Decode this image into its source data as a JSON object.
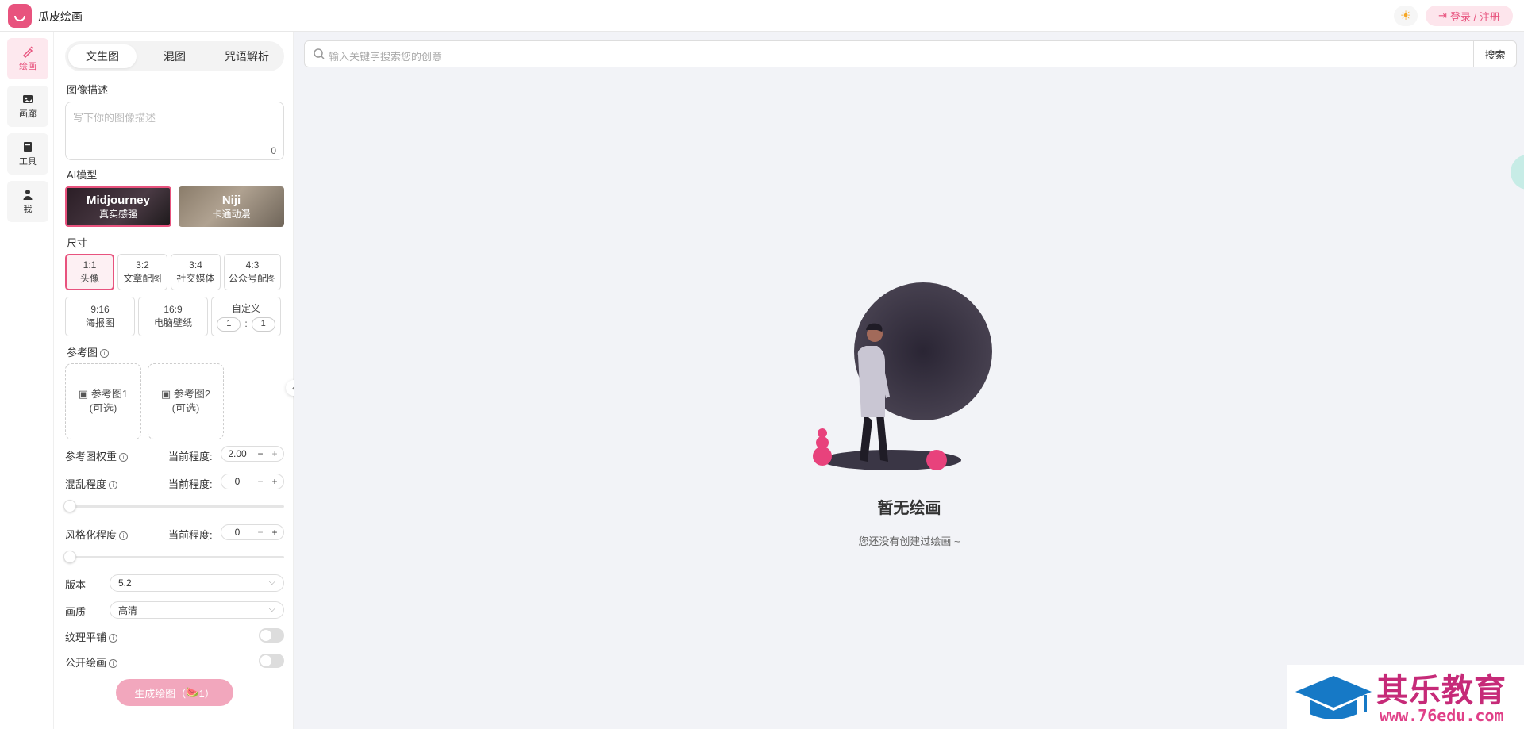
{
  "header": {
    "app_title": "瓜皮绘画",
    "login_label": "登录 / 注册"
  },
  "nav": [
    {
      "label": "绘画"
    },
    {
      "label": "画廊"
    },
    {
      "label": "工具"
    },
    {
      "label": "我"
    }
  ],
  "tabs": [
    {
      "label": "文生图"
    },
    {
      "label": "混图"
    },
    {
      "label": "咒语解析"
    }
  ],
  "prompt": {
    "label": "图像描述",
    "placeholder": "写下你的图像描述",
    "count": "0"
  },
  "model": {
    "label": "AI模型",
    "items": [
      {
        "name": "Midjourney",
        "desc": "真实感强"
      },
      {
        "name": "Niji",
        "desc": "卡通动漫"
      }
    ]
  },
  "size": {
    "label": "尺寸",
    "items": [
      {
        "ratio": "1:1",
        "desc": "头像"
      },
      {
        "ratio": "3:2",
        "desc": "文章配图"
      },
      {
        "ratio": "3:4",
        "desc": "社交媒体"
      },
      {
        "ratio": "4:3",
        "desc": "公众号配图"
      },
      {
        "ratio": "9:16",
        "desc": "海报图"
      },
      {
        "ratio": "16:9",
        "desc": "电脑壁纸"
      }
    ],
    "custom": {
      "label": "自定义",
      "w": "1",
      "sep": ":",
      "h": "1"
    }
  },
  "reference": {
    "label": "参考图",
    "items": [
      {
        "label": "参考图1",
        "sub": "(可选)"
      },
      {
        "label": "参考图2",
        "sub": "(可选)"
      }
    ]
  },
  "params": {
    "current_label": "当前程度:",
    "ref_weight": {
      "label": "参考图权重",
      "value": "2.00",
      "minus": "−",
      "plus": "+"
    },
    "chaos": {
      "label": "混乱程度",
      "value": "0",
      "minus": "−",
      "plus": "+",
      "level": 0
    },
    "stylize": {
      "label": "风格化程度",
      "value": "0",
      "minus": "−",
      "plus": "+",
      "level": 0
    }
  },
  "version": {
    "label": "版本",
    "value": "5.2"
  },
  "quality": {
    "label": "画质",
    "value": "高清"
  },
  "tile": {
    "label": "纹理平铺",
    "on": false
  },
  "public": {
    "label": "公开绘画",
    "on": false
  },
  "generate": {
    "label": "生成绘图（",
    "count": "1）"
  },
  "search": {
    "placeholder": "输入关键字搜索您的创意",
    "button": "搜索"
  },
  "empty": {
    "title": "暂无绘画",
    "subtitle": "您还没有创建过绘画 ~"
  },
  "watermark": {
    "title": "其乐教育",
    "url": "www.76edu.com"
  },
  "colors": {
    "accent": "#e8537e",
    "main_bg": "#f2f3f7"
  },
  "icons": {
    "theme": "sun-icon",
    "login": "login-icon",
    "search": "search-icon",
    "collapse": "chevron-left-icon"
  }
}
